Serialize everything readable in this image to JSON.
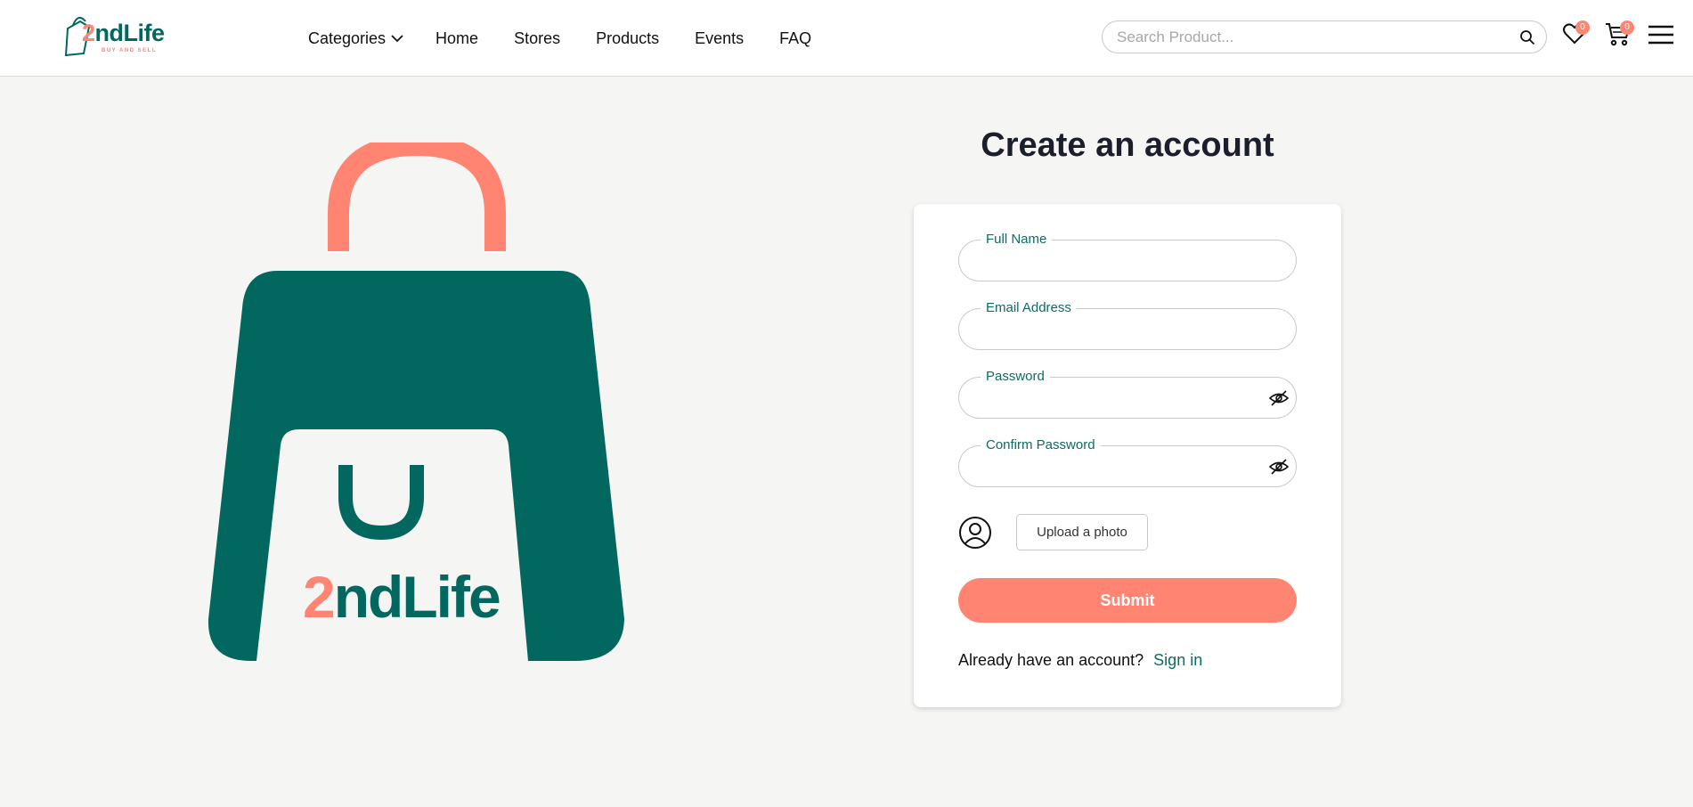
{
  "brand": {
    "name_prefix": "2",
    "name_suffix": "ndLife",
    "tagline": "BUY AND SELL"
  },
  "nav": {
    "items": [
      {
        "label": "Categories"
      },
      {
        "label": "Home"
      },
      {
        "label": "Stores"
      },
      {
        "label": "Products"
      },
      {
        "label": "Events"
      },
      {
        "label": "FAQ"
      }
    ]
  },
  "search": {
    "placeholder": "Search Product..."
  },
  "wishlist": {
    "count": "0"
  },
  "cart": {
    "count": "0"
  },
  "hero": {
    "brand_prefix": "2",
    "brand_suffix": "ndLife"
  },
  "form": {
    "title": "Create an account",
    "full_name_label": "Full Name",
    "email_label": "Email Address",
    "password_label": "Password",
    "confirm_password_label": "Confirm Password",
    "upload_label": "Upload a photo",
    "submit_label": "Submit",
    "signin_prompt": "Already have an account?",
    "signin_link": "Sign in"
  },
  "colors": {
    "brand_teal": "#01675f",
    "accent_coral": "#ff8472",
    "background": "#f5f5f3"
  },
  "icons": [
    "chevron-down-icon",
    "search-icon",
    "heart-icon",
    "cart-icon",
    "menu-icon",
    "eye-off-icon",
    "user-circle-icon"
  ]
}
